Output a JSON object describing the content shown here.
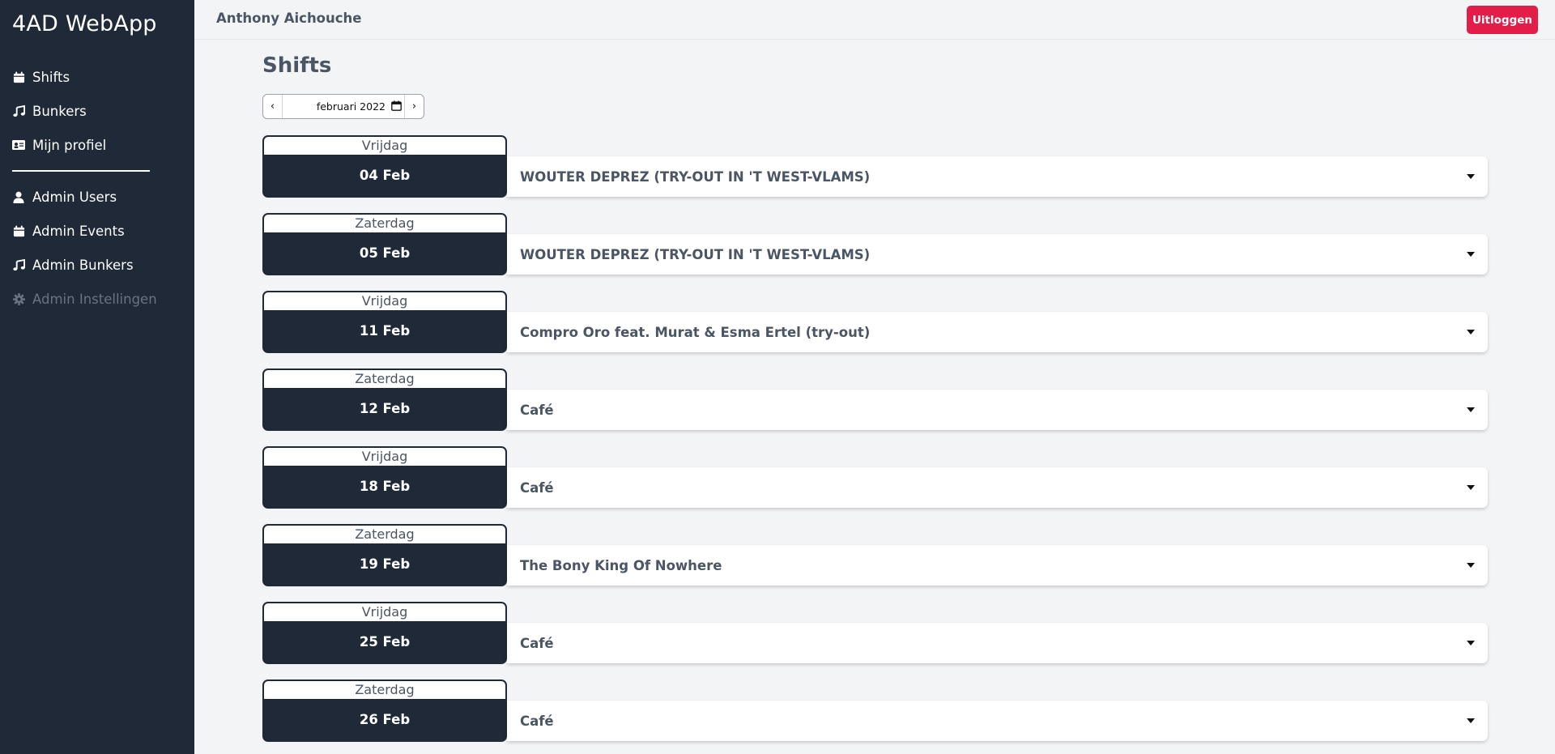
{
  "app": {
    "brand": "4AD WebApp"
  },
  "sidebar": {
    "items": [
      {
        "label": "Shifts",
        "icon": "calendar-icon"
      },
      {
        "label": "Bunkers",
        "icon": "music-note-icon"
      },
      {
        "label": "Mijn profiel",
        "icon": "id-card-icon"
      }
    ],
    "admin_items": [
      {
        "label": "Admin Users",
        "icon": "user-icon"
      },
      {
        "label": "Admin Events",
        "icon": "calendar-icon"
      },
      {
        "label": "Admin Bunkers",
        "icon": "music-note-icon"
      },
      {
        "label": "Admin Instellingen",
        "icon": "gear-icon",
        "disabled": true
      }
    ]
  },
  "header": {
    "user_name": "Anthony Aichouche",
    "logout_label": "Uitloggen"
  },
  "main": {
    "title": "Shifts",
    "month_picker": {
      "value": "februari 2022",
      "prev": "‹",
      "next": "›"
    },
    "shifts": [
      {
        "day": "Vrijdag",
        "date": "04 Feb",
        "event": "WOUTER DEPREZ (TRY-OUT IN 'T WEST-VLAMS)"
      },
      {
        "day": "Zaterdag",
        "date": "05 Feb",
        "event": "WOUTER DEPREZ (TRY-OUT IN 'T WEST-VLAMS)"
      },
      {
        "day": "Vrijdag",
        "date": "11 Feb",
        "event": "Compro Oro feat. Murat & Esma Ertel (try-out)"
      },
      {
        "day": "Zaterdag",
        "date": "12 Feb",
        "event": "Café"
      },
      {
        "day": "Vrijdag",
        "date": "18 Feb",
        "event": "Café"
      },
      {
        "day": "Zaterdag",
        "date": "19 Feb",
        "event": "The Bony King Of Nowhere"
      },
      {
        "day": "Vrijdag",
        "date": "25 Feb",
        "event": "Café"
      },
      {
        "day": "Zaterdag",
        "date": "26 Feb",
        "event": "Café"
      }
    ]
  },
  "colors": {
    "sidebar_bg": "#1f2937",
    "page_bg": "#f3f4f6",
    "logout_bg": "#e11d48",
    "text": "#4b5563"
  }
}
